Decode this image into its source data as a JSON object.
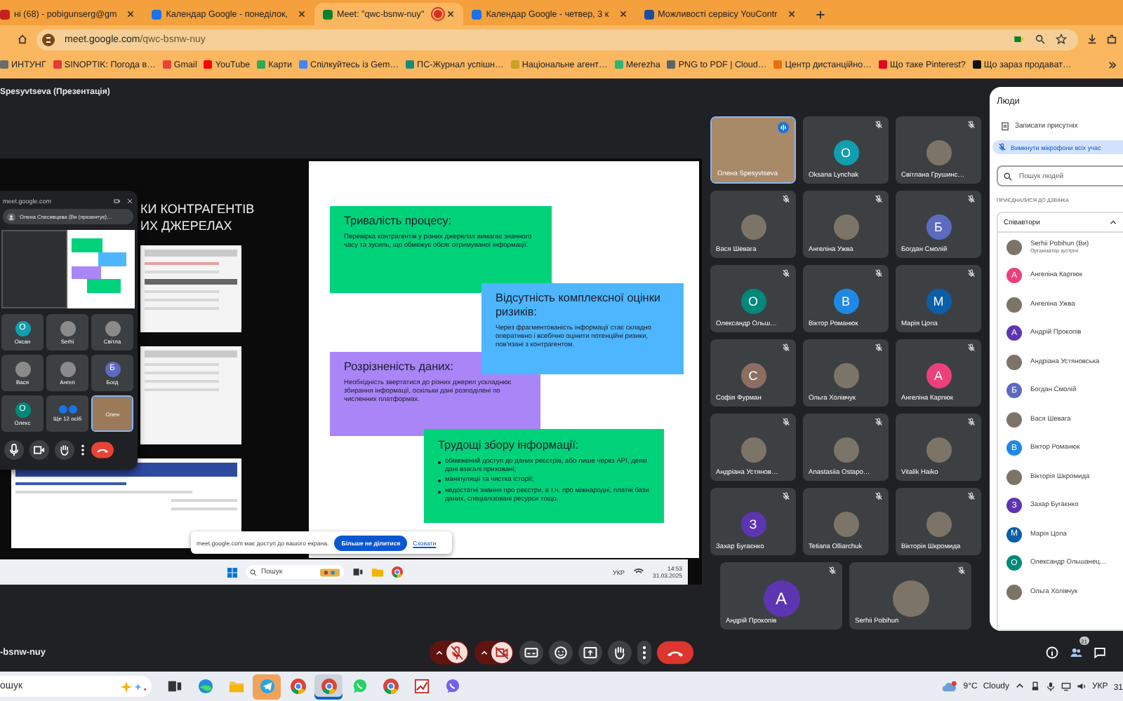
{
  "browser": {
    "tabs": [
      {
        "title": "ні (68) - pobigunserg@gm",
        "color": "#c5221f",
        "selected": false,
        "recording": false
      },
      {
        "title": "Календар Google - понеділок,",
        "color": "#1a73e8",
        "selected": false,
        "recording": false
      },
      {
        "title": "Meet: \"qwc-bsnw-nuy\"",
        "color": "#00832d",
        "selected": true,
        "recording": true
      },
      {
        "title": "Календар Google - четвер, 3 к",
        "color": "#1a73e8",
        "selected": false,
        "recording": false
      },
      {
        "title": "Можливості сервісу YouContr",
        "color": "#1d4fa0",
        "selected": false,
        "recording": false
      }
    ],
    "url_host": "meet.google.com",
    "url_path": "/qwc-bsnw-nuy",
    "bookmarks": [
      {
        "label": "ИНТУНГ",
        "color": "#6b6b6b"
      },
      {
        "label": "SINOPTIK: Погода в…",
        "color": "#e53935"
      },
      {
        "label": "Gmail",
        "color": "#ea4335"
      },
      {
        "label": "YouTube",
        "color": "#ff0000"
      },
      {
        "label": "Карти",
        "color": "#34a853"
      },
      {
        "label": "Спілкуйтесь із Gem…",
        "color": "#4285f4"
      },
      {
        "label": "ПС-Журнал успішн…",
        "color": "#1b8a7a"
      },
      {
        "label": "Національне агент…",
        "color": "#c9a227"
      },
      {
        "label": "Merezha",
        "color": "#2bb673"
      },
      {
        "label": "PNG to PDF | Cloud…",
        "color": "#5f6368"
      },
      {
        "label": "Центр дистанційно…",
        "color": "#e8710a"
      },
      {
        "label": "Що таке Pinterest?",
        "color": "#e60023"
      },
      {
        "label": "Що зараз продават…",
        "color": "#111111"
      }
    ]
  },
  "meet": {
    "header": "Spesyvtseva (Презентація)",
    "presentation": {
      "title_lines": [
        "КИ КОНТРАГЕНТІВ",
        "ИХ ДЖЕРЕЛАХ"
      ],
      "cards": [
        {
          "kind": "text",
          "color": "#00d27a",
          "title": "Тривалість процесу:",
          "body": "Перевірка контрагентів у різних джерелах вимагає значного часу та зусиль, що обмежує обсяг отримуваної інформації."
        },
        {
          "kind": "text",
          "color": "#4db6ff",
          "title": "Відсутність комплексної оцінки ризиків:",
          "body": "Через фрагментованість інформації стає складно оперативно і всебічно оцінити потенційні ризики, пов'язані з контрагентом."
        },
        {
          "kind": "text",
          "color": "#a985f7",
          "title": "Розрізненість даних:",
          "body": "Необхідність звертатися до різних джерел ускладнює збирання інформації, оскільки дані розподілені по численних платформах."
        },
        {
          "kind": "list",
          "color": "#00d27a",
          "title": "Трудощі збору інформації:",
          "items": [
            "обмежений доступ до даних реєстрів, або лише через API, деякі дані взагалі приховані;",
            "маніпуляції та чистка історії;",
            "недостатні знання про реєстри, в т.ч. про міжнародні, платні бази даних, спеціалізовані ресурси тощо."
          ]
        }
      ],
      "share_banner": {
        "text": "meet.google.com має доступ до вашого екрана.",
        "stop_button": "Більше не ділитися",
        "hide_link": "Сховати"
      },
      "screen_taskbar": {
        "search": "Пошук",
        "language": "УКР",
        "time": "14:53",
        "date": "31.03.2025"
      },
      "mini_window": {
        "url": "meet.google.com",
        "presenter": "Олена Спесивцева (Ви (презентує)…",
        "tiles": [
          {
            "name": "Оксан",
            "kind": "letter",
            "letter": "О",
            "color": "#129eaf"
          },
          {
            "name": "Serhi",
            "kind": "photo"
          },
          {
            "name": "Світла",
            "kind": "photo"
          },
          {
            "name": "Вася",
            "kind": "photo"
          },
          {
            "name": "Ангел",
            "kind": "photo"
          },
          {
            "name": "Богд",
            "kind": "letter",
            "letter": "Б",
            "color": "#5c6bc0"
          },
          {
            "name": "Олекс",
            "kind": "letter",
            "letter": "О",
            "color": "#00897b"
          },
          {
            "name": "Ще 12 осіб",
            "kind": "more"
          },
          {
            "name": "Олен",
            "kind": "video"
          }
        ]
      }
    },
    "participants": [
      {
        "name": "Олена Spesyvtseva",
        "kind": "video",
        "speaking": true
      },
      {
        "name": "Oksana Lynchak",
        "kind": "letter",
        "letter": "О",
        "color": "#129eaf",
        "speaking": false
      },
      {
        "name": "Світлана Грушинс…",
        "kind": "photo",
        "speaking": false
      },
      {
        "name": "Вася Шевага",
        "kind": "photo",
        "speaking": false
      },
      {
        "name": "Ангеліна Ужва",
        "kind": "photo",
        "speaking": false
      },
      {
        "name": "Богдан Смолій",
        "kind": "letter",
        "letter": "Б",
        "color": "#5c6bc0",
        "speaking": false
      },
      {
        "name": "Олександр Ольш…",
        "kind": "letter",
        "letter": "О",
        "color": "#00897b",
        "speaking": false
      },
      {
        "name": "Віктор Романюк",
        "kind": "letter",
        "letter": "В",
        "color": "#1e88e5",
        "speaking": false
      },
      {
        "name": "Марія Цопа",
        "kind": "letter",
        "letter": "М",
        "color": "#0b5ea8",
        "speaking": false
      },
      {
        "name": "Софія Фурман",
        "kind": "letter",
        "letter": "С",
        "color": "#8d6e63",
        "speaking": false
      },
      {
        "name": "Ольга Холівчук",
        "kind": "photo",
        "speaking": false
      },
      {
        "name": "Ангеліна Карпюк",
        "kind": "letter",
        "letter": "А",
        "color": "#ec407a",
        "speaking": false
      },
      {
        "name": "Андріана Устянов…",
        "kind": "photo",
        "speaking": false
      },
      {
        "name": "Anastasiia Ostapo…",
        "kind": "photo",
        "speaking": false
      },
      {
        "name": "Vitalik Haiko",
        "kind": "photo",
        "speaking": false
      },
      {
        "name": "Захар Бугаєнко",
        "kind": "letter",
        "letter": "З",
        "color": "#5e35b1",
        "speaking": false
      },
      {
        "name": "Tetiana Olliarchuk",
        "kind": "photo",
        "speaking": false
      },
      {
        "name": "Вікторія Шкромида",
        "kind": "photo",
        "speaking": false
      },
      {
        "name": "Андрій Прокопів",
        "kind": "letter",
        "letter": "А",
        "color": "#5e35b1",
        "speaking": false
      },
      {
        "name": "Serhii Pobihun",
        "kind": "photo",
        "speaking": false
      }
    ],
    "people_panel": {
      "title": "Люди",
      "record_attendance": "Записати присутніх",
      "mute_all": "Вимкнути мікрофони всіх учас",
      "search_placeholder": "Пошук людей",
      "section": "ПРИЄДНАЛИСЯ ДО ДЗВІНКА",
      "group": {
        "title": "Співавтори",
        "expanded": true
      },
      "people": [
        {
          "name": "Serhii Pobihun (Ви)",
          "role": "Організатор зустрічі",
          "kind": "photo"
        },
        {
          "name": "Ангеліна Карпюк",
          "kind": "letter",
          "letter": "А",
          "color": "#ec407a"
        },
        {
          "name": "Ангеліна Ужва",
          "kind": "photo"
        },
        {
          "name": "Андрій Прокопів",
          "kind": "letter",
          "letter": "А",
          "color": "#5e35b1"
        },
        {
          "name": "Андріана Устяновська",
          "kind": "photo"
        },
        {
          "name": "Богдан Смолій",
          "kind": "letter",
          "letter": "Б",
          "color": "#5c6bc0"
        },
        {
          "name": "Вася Шевага",
          "kind": "photo"
        },
        {
          "name": "Віктор Романюк",
          "kind": "letter",
          "letter": "В",
          "color": "#1e88e5"
        },
        {
          "name": "Вікторія Шкромида",
          "kind": "photo"
        },
        {
          "name": "Захар Бугаєнко",
          "kind": "letter",
          "letter": "З",
          "color": "#5e35b1"
        },
        {
          "name": "Марія Цопа",
          "kind": "letter",
          "letter": "М",
          "color": "#0b5ea8"
        },
        {
          "name": "Олександр Ольшанец…",
          "kind": "letter",
          "letter": "О",
          "color": "#00897b"
        },
        {
          "name": "Ольга Холівчук",
          "kind": "photo"
        }
      ]
    },
    "controls": {
      "meeting_code": "-bsnw-nuy",
      "mic_on": false,
      "camera_on": false,
      "participant_count": "21"
    }
  },
  "taskbar": {
    "search": "ошук",
    "apps": [
      {
        "kind": "task-view",
        "selected": false,
        "flashing": false
      },
      {
        "kind": "browser-wave",
        "selected": false,
        "flashing": false
      },
      {
        "kind": "folder",
        "selected": false,
        "flashing": false
      },
      {
        "kind": "messenger-plane",
        "selected": false,
        "flashing": true
      },
      {
        "kind": "browser-round",
        "selected": false,
        "flashing": false
      },
      {
        "kind": "browser-round",
        "selected": true,
        "flashing": false
      },
      {
        "kind": "chat-phone",
        "selected": false,
        "flashing": false
      },
      {
        "kind": "browser-round",
        "selected": false,
        "flashing": false
      },
      {
        "kind": "chart",
        "selected": false,
        "flashing": false
      },
      {
        "kind": "messenger-bubble",
        "selected": false,
        "flashing": false
      }
    ],
    "temperature": "9°C",
    "weather": "Cloudy",
    "language": "УКР",
    "clock": "31"
  }
}
